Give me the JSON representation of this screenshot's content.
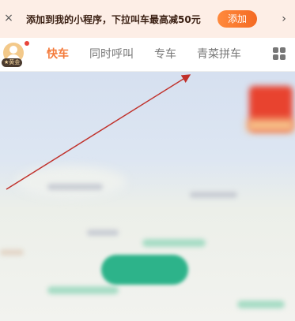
{
  "banner": {
    "close_icon": "×",
    "text": "添加到我的小程序，下拉叫车最高减50元",
    "add_label": "添加",
    "chevron_icon": "›"
  },
  "nav": {
    "badge_label": "★黄金",
    "tabs": [
      {
        "label": "快车",
        "active": true
      },
      {
        "label": "同时呼叫",
        "active": false
      },
      {
        "label": "专车",
        "active": false
      },
      {
        "label": "青菜拼车",
        "active": false
      }
    ],
    "grid_icon": "grid-icon"
  },
  "colors": {
    "accent": "#f47a3a",
    "banner_bg": "#fdeee6",
    "arrow": "#c0302a"
  }
}
